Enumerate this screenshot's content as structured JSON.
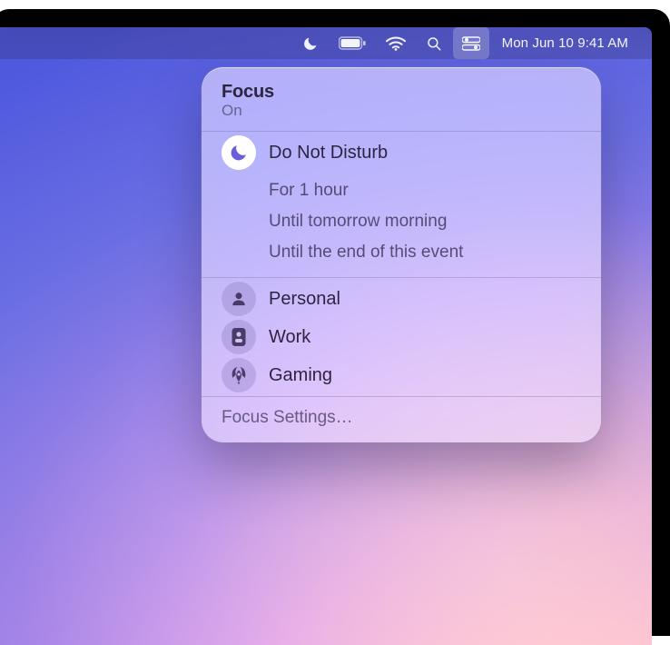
{
  "menubar": {
    "datetime": "Mon Jun 10  9:41 AM",
    "icons": {
      "focus": "moon-icon",
      "battery": "battery-icon",
      "wifi": "wifi-icon",
      "search": "search-icon",
      "control_center": "control-center-icon"
    }
  },
  "focus_panel": {
    "title": "Focus",
    "status": "On",
    "active_mode": {
      "icon": "moon-icon",
      "label": "Do Not Disturb"
    },
    "duration_options": [
      "For 1 hour",
      "Until tomorrow morning",
      "Until the end of this event"
    ],
    "other_modes": [
      {
        "icon": "person-icon",
        "label": "Personal"
      },
      {
        "icon": "badge-icon",
        "label": "Work"
      },
      {
        "icon": "rocket-icon",
        "label": "Gaming"
      }
    ],
    "settings_label": "Focus Settings…"
  },
  "colors": {
    "active_pill_bg": "#ffffff",
    "active_icon": "#6b5ed6",
    "inactive_icon": "#4a3a6a"
  }
}
